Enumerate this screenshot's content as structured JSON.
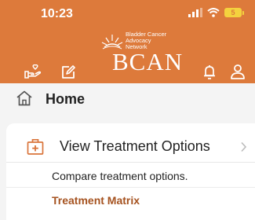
{
  "status_bar": {
    "time": "10:23",
    "battery": "5"
  },
  "brand": {
    "name": "BCAN",
    "tagline_lines": [
      "Bladder Cancer",
      "Advocacy",
      "Network"
    ],
    "logo_icon": "rising-sun-icon"
  },
  "nav": {
    "left_icons": [
      "hand-heart-icon",
      "edit-note-icon"
    ],
    "right_icons": [
      "bell-icon",
      "user-icon"
    ]
  },
  "page": {
    "title": "Home",
    "icon": "home-icon"
  },
  "card": {
    "icon": "medical-kit-icon",
    "title": "View Treatment Options",
    "description": "Compare treatment options.",
    "link": "Treatment Matrix"
  },
  "colors": {
    "header": "#dd7a3b",
    "link": "#a5521f",
    "background": "#f4f4f4"
  }
}
